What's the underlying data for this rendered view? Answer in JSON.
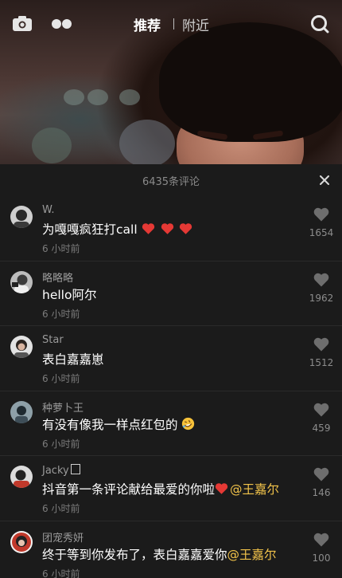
{
  "topbar": {
    "tab_recommend": "推荐",
    "tab_nearby": "附近",
    "icons": [
      "camera-icon",
      "live-dots-icon",
      "search-icon"
    ]
  },
  "comments_panel": {
    "title": "6435条评论",
    "close_icon": "close-icon",
    "accent_color": "#f2c34a",
    "comments": [
      {
        "user": "W.",
        "text": "为嘎嘎疯狂打call",
        "hearts": 3,
        "time": "6 小时前",
        "likes": "1654"
      },
      {
        "user": "略略略",
        "text": "hello阿尔",
        "time": "6 小时前",
        "likes": "1962"
      },
      {
        "user": "Star",
        "text": "表白嘉嘉崽",
        "time": "6 小时前",
        "likes": "1512"
      },
      {
        "user": "种萝卜王",
        "text": "有没有像我一样点红包的",
        "emoji": "rofl-emoji",
        "time": "6 小时前",
        "likes": "459"
      },
      {
        "user": "Jacky",
        "text": "抖音第一条评论献给最爱的你啦",
        "mention": "@王嘉尔",
        "time": "6 小时前",
        "likes": "146"
      },
      {
        "user": "团宠秀妍",
        "text": "终于等到你发布了，表白嘉嘉爱你",
        "mention": "@王嘉尔",
        "time": "6 小时前",
        "likes": "100"
      }
    ]
  }
}
